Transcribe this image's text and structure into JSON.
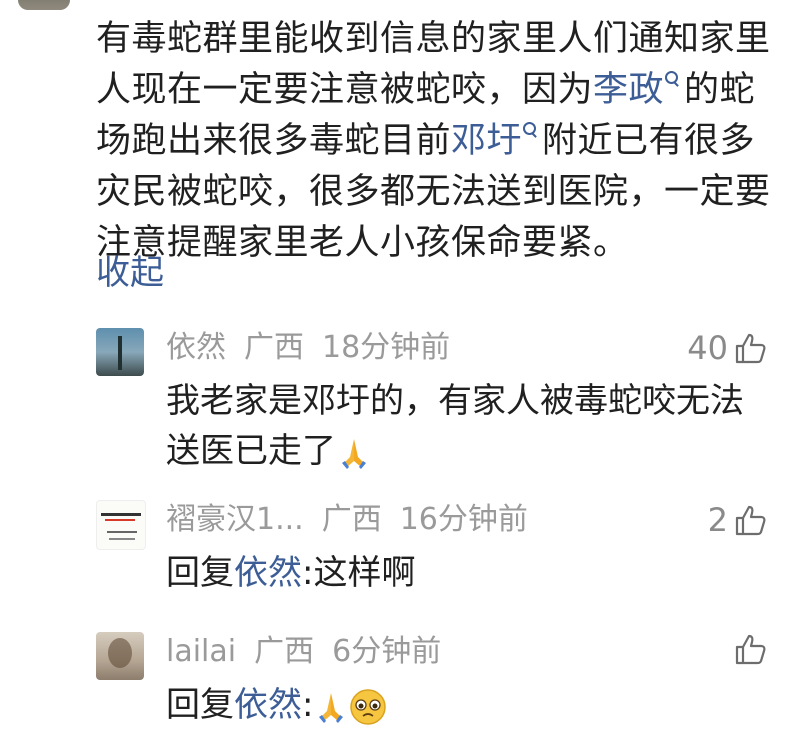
{
  "post": {
    "text_1": "有毒蛇群里能收到信息的家里人们通知家里人现在一定要注意被蛇咬，因为",
    "link_1": "李政",
    "text_2": "的蛇场跑出来很多毒蛇目前",
    "link_2": "邓圩",
    "text_3": "附近已有很多灾民被蛇咬，很多都无法送到医院，一定要注意提醒家里老人小孩保命要紧。",
    "collapse_label": "收起"
  },
  "comments": [
    {
      "username": "依然",
      "location": "广西",
      "time": "18分钟前",
      "likes": "40",
      "text": "我老家是邓圩的，有家人被毒蛇咬无法送医已走了",
      "emoji": "folded-hands"
    },
    {
      "username": "褶豪汉1...",
      "location": "广西",
      "time": "16分钟前",
      "likes": "2",
      "reply_prefix": "回复",
      "reply_to": "依然",
      "reply_text": ":这样啊"
    },
    {
      "username": "lailai",
      "location": "广西",
      "time": "6分钟前",
      "likes": "",
      "reply_prefix": "回复",
      "reply_to": "依然",
      "reply_text": ":",
      "emoji": [
        "folded-hands",
        "pleading-face"
      ]
    }
  ],
  "colors": {
    "link": "#3d5d96",
    "meta": "#9a9a9a",
    "text": "#202020"
  }
}
